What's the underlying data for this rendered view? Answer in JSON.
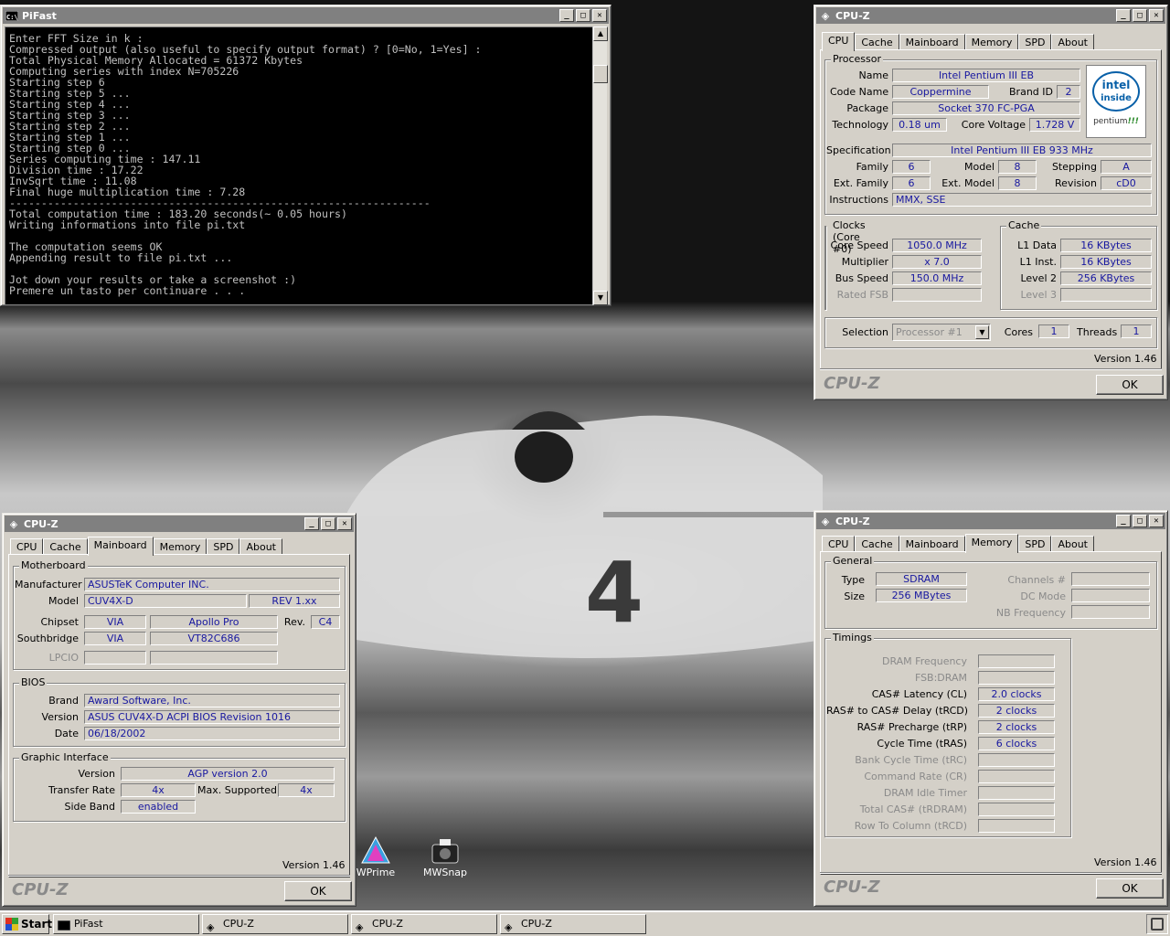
{
  "pifast": {
    "title": "PiFast",
    "console_lines": [
      "Enter FFT Size in k :",
      "Compressed output (also useful to specify output format) ? [0=No, 1=Yes] :",
      "Total Physical Memory Allocated = 61372 Kbytes",
      "Computing series with index N=705226",
      "Starting step 6",
      "Starting step 5 ...",
      "Starting step 4 ...",
      "Starting step 3 ...",
      "Starting step 2 ...",
      "Starting step 1 ...",
      "Starting step 0 ...",
      "Series computing time : 147.11",
      "Division time : 17.22",
      "InvSqrt time : 11.08",
      "Final huge multiplication time : 7.28",
      "------------------------------------------------------------------",
      "Total computation time : 183.20 seconds(~ 0.05 hours)",
      "Writing informations into file pi.txt",
      "",
      "The computation seems OK",
      "Appending result to file pi.txt ...",
      "",
      "Jot down your results or take a screenshot :)",
      "Premere un tasto per continuare . . ."
    ]
  },
  "cpuz_common": {
    "title": "CPU-Z",
    "tabs": [
      "CPU",
      "Cache",
      "Mainboard",
      "Memory",
      "SPD",
      "About"
    ],
    "version": "Version 1.46",
    "brand": "CPU-Z",
    "ok": "OK"
  },
  "cpu": {
    "processor_group": "Processor",
    "name_label": "Name",
    "name": "Intel Pentium III EB",
    "codename_label": "Code Name",
    "codename": "Coppermine",
    "brandid_label": "Brand ID",
    "brandid": "2",
    "package_label": "Package",
    "package": "Socket 370 FC-PGA",
    "tech_label": "Technology",
    "tech": "0.18 um",
    "voltage_label": "Core Voltage",
    "voltage": "1.728 V",
    "spec_label": "Specification",
    "spec": "Intel Pentium III EB 933 MHz",
    "family_label": "Family",
    "family": "6",
    "model_label": "Model",
    "model": "8",
    "stepping_label": "Stepping",
    "stepping": "A",
    "extfamily_label": "Ext. Family",
    "extfamily": "6",
    "extmodel_label": "Ext. Model",
    "extmodel": "8",
    "revision_label": "Revision",
    "revision": "cD0",
    "instr_label": "Instructions",
    "instr": "MMX, SSE",
    "logo_intel": "intel",
    "logo_inside": "inside",
    "logo_pentium": "pentium",
    "logo_numeral": "!!!",
    "clocks_group": "Clocks (Core #0)",
    "corespeed_label": "Core Speed",
    "corespeed": "1050.0 MHz",
    "multiplier_label": "Multiplier",
    "multiplier": "x 7.0",
    "busspeed_label": "Bus Speed",
    "busspeed": "150.0 MHz",
    "ratedfsb_label": "Rated FSB",
    "ratedfsb": "",
    "cache_group": "Cache",
    "l1data_label": "L1 Data",
    "l1data": "16 KBytes",
    "l1inst_label": "L1 Inst.",
    "l1inst": "16 KBytes",
    "level2_label": "Level 2",
    "level2": "256 KBytes",
    "level3_label": "Level 3",
    "level3": "",
    "selection_label": "Selection",
    "selection": "Processor #1",
    "cores_label": "Cores",
    "cores": "1",
    "threads_label": "Threads",
    "threads": "1"
  },
  "mainboard": {
    "mb_group": "Motherboard",
    "manufacturer_label": "Manufacturer",
    "manufacturer": "ASUSTeK Computer INC.",
    "model_label": "Model",
    "model": "CUV4X-D",
    "model_rev": "REV 1.xx",
    "chipset_label": "Chipset",
    "chipset_vendor": "VIA",
    "chipset_name": "Apollo Pro",
    "rev_label": "Rev.",
    "rev": "C4",
    "southbridge_label": "Southbridge",
    "sb_vendor": "VIA",
    "sb_name": "VT82C686",
    "lpcio_label": "LPCIO",
    "lpcio_vendor": "",
    "lpcio_name": "",
    "bios_group": "BIOS",
    "brand_label": "Brand",
    "brand": "Award Software, Inc.",
    "version_label": "Version",
    "version": "ASUS CUV4X-D ACPI BIOS Revision 1016",
    "date_label": "Date",
    "date": "06/18/2002",
    "gi_group": "Graphic Interface",
    "gi_version_label": "Version",
    "gi_version": "AGP version 2.0",
    "transfer_label": "Transfer Rate",
    "transfer": "4x",
    "maxsup_label": "Max. Supported",
    "maxsup": "4x",
    "sideband_label": "Side Band",
    "sideband": "enabled"
  },
  "memory": {
    "general_group": "General",
    "type_label": "Type",
    "type": "SDRAM",
    "size_label": "Size",
    "size": "256 MBytes",
    "channels_label": "Channels #",
    "channels": "",
    "dcmode_label": "DC Mode",
    "dcmode": "",
    "nbfreq_label": "NB Frequency",
    "nbfreq": "",
    "timings_group": "Timings",
    "timings": [
      {
        "label": "DRAM Frequency",
        "value": "",
        "enabled": false
      },
      {
        "label": "FSB:DRAM",
        "value": "",
        "enabled": false
      },
      {
        "label": "CAS# Latency (CL)",
        "value": "2.0 clocks",
        "enabled": true
      },
      {
        "label": "RAS# to CAS# Delay (tRCD)",
        "value": "2 clocks",
        "enabled": true
      },
      {
        "label": "RAS# Precharge (tRP)",
        "value": "2 clocks",
        "enabled": true
      },
      {
        "label": "Cycle Time (tRAS)",
        "value": "6 clocks",
        "enabled": true
      },
      {
        "label": "Bank Cycle Time (tRC)",
        "value": "",
        "enabled": false
      },
      {
        "label": "Command Rate (CR)",
        "value": "",
        "enabled": false
      },
      {
        "label": "DRAM Idle Timer",
        "value": "",
        "enabled": false
      },
      {
        "label": "Total CAS# (tRDRAM)",
        "value": "",
        "enabled": false
      },
      {
        "label": "Row To Column (tRCD)",
        "value": "",
        "enabled": false
      }
    ]
  },
  "desktop_icons": [
    {
      "label": "WPrime",
      "icon": "wprime-icon"
    },
    {
      "label": "MWSnap",
      "icon": "camera-icon"
    }
  ],
  "race_car_number": "4",
  "taskbar": {
    "start": "Start",
    "items": [
      "PiFast",
      "CPU-Z",
      "CPU-Z",
      "CPU-Z"
    ]
  },
  "colors": {
    "field_text": "#1818a0",
    "title_inactive": "#808080",
    "window": "#d4d0c8"
  }
}
